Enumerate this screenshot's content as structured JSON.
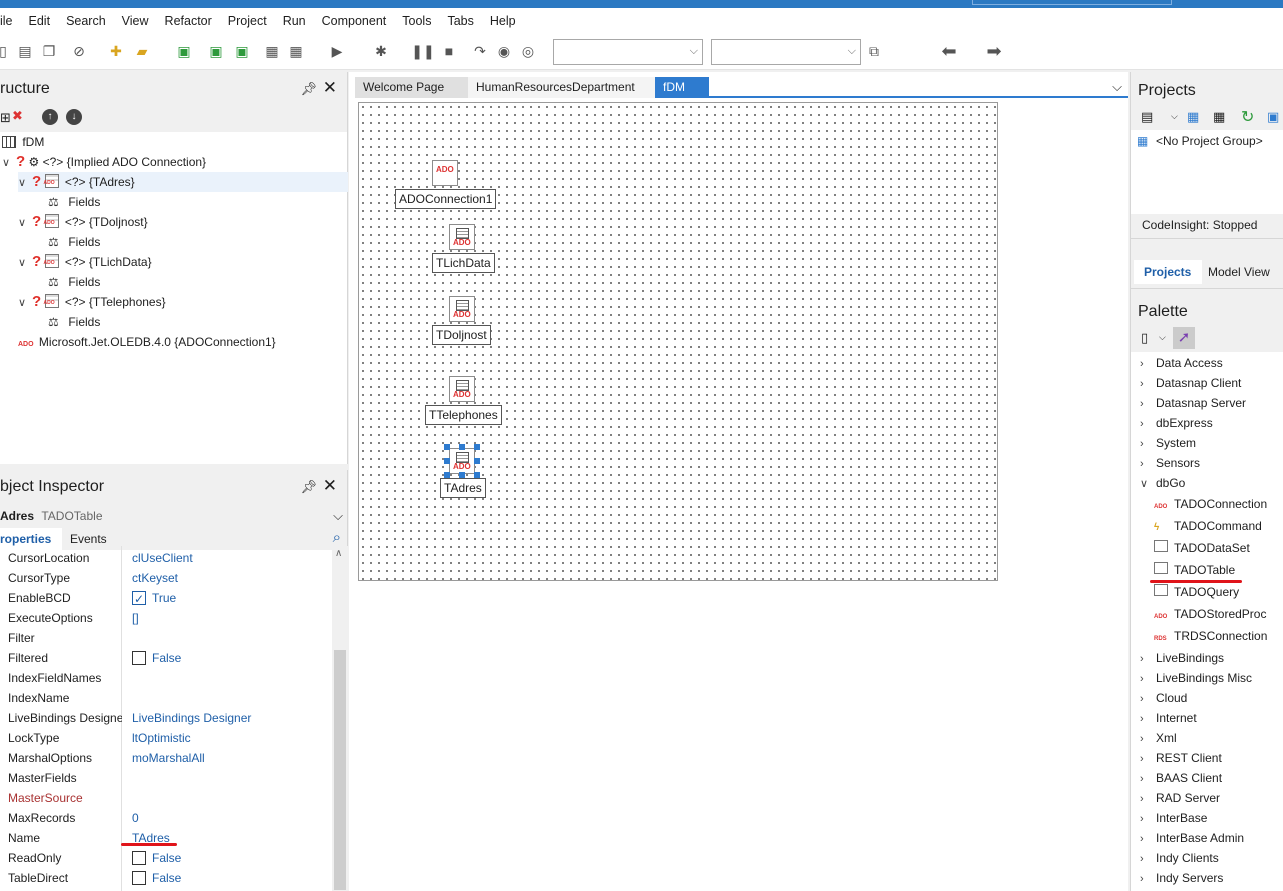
{
  "menubar": {
    "items": [
      "ile",
      "Edit",
      "Search",
      "View",
      "Refactor",
      "Project",
      "Run",
      "Component",
      "Tools",
      "Tabs",
      "Help"
    ]
  },
  "toolbar": {
    "combo1_value": "",
    "combo2_value": ""
  },
  "structure": {
    "title": "ructure",
    "rows": [
      {
        "label": "fDM"
      },
      {
        "label": "<?> {Implied ADO Connection}"
      },
      {
        "label": "<?> {TAdres}"
      },
      {
        "label": "Fields"
      },
      {
        "label": "<?> {TDoljnost}"
      },
      {
        "label": "Fields"
      },
      {
        "label": "<?> {TLichData}"
      },
      {
        "label": "Fields"
      },
      {
        "label": "<?> {TTelephones}"
      },
      {
        "label": "Fields"
      },
      {
        "label": "Microsoft.Jet.OLEDB.4.0 {ADOConnection1}"
      }
    ]
  },
  "inspector": {
    "title": "bject Inspector",
    "selected_name": "Adres",
    "selected_type": "TADOTable",
    "tabs": [
      "roperties",
      "Events"
    ],
    "properties": [
      {
        "name": "CursorLocation",
        "value": "clUseClient"
      },
      {
        "name": "CursorType",
        "value": "ctKeyset"
      },
      {
        "name": "EnableBCD",
        "value": "True",
        "checkbox": true,
        "checked": true
      },
      {
        "name": "ExecuteOptions",
        "value": "[]"
      },
      {
        "name": "Filter",
        "value": ""
      },
      {
        "name": "Filtered",
        "value": "False",
        "checkbox": true,
        "checked": false
      },
      {
        "name": "IndexFieldNames",
        "value": ""
      },
      {
        "name": "IndexName",
        "value": ""
      },
      {
        "name": "LiveBindings Designe",
        "value": "LiveBindings Designer"
      },
      {
        "name": "LockType",
        "value": "ltOptimistic"
      },
      {
        "name": "MarshalOptions",
        "value": "moMarshalAll"
      },
      {
        "name": "MasterFields",
        "value": ""
      },
      {
        "name": "MasterSource",
        "value": "",
        "link": true
      },
      {
        "name": "MaxRecords",
        "value": "0"
      },
      {
        "name": "Name",
        "value": "TAdres"
      },
      {
        "name": "ReadOnly",
        "value": "False",
        "checkbox": true,
        "checked": false
      },
      {
        "name": "TableDirect",
        "value": "False",
        "checkbox": true,
        "checked": false
      }
    ]
  },
  "editor_tabs": {
    "welcome": "Welcome Page",
    "hr": "HumanResourcesDepartment",
    "fdm": "fDM"
  },
  "form_components": [
    {
      "label": "ADOConnection1",
      "icon_text": "ADO"
    },
    {
      "label": "TLichData"
    },
    {
      "label": "TDoljnost"
    },
    {
      "label": "TTelephones"
    },
    {
      "label": "TAdres"
    }
  ],
  "projects": {
    "title": "Projects",
    "group": "<No Project Group>",
    "codeinsight": "CodeInsight: Stopped",
    "tab_projects": "Projects",
    "tab_model": "Model View"
  },
  "palette": {
    "title": "Palette",
    "categories_top": [
      "Data Access",
      "Datasnap Client",
      "Datasnap Server",
      "dbExpress",
      "System",
      "Sensors"
    ],
    "expanded": "dbGo",
    "dbgo_items": [
      "TADOConnection",
      "TADOCommand",
      "TADODataSet",
      "TADOTable",
      "TADOQuery",
      "TADOStoredProc",
      "TRDSConnection"
    ],
    "categories_bottom": [
      "LiveBindings",
      "LiveBindings Misc",
      "Cloud",
      "Internet",
      "Xml",
      "REST Client",
      "BAAS Client",
      "RAD Server",
      "InterBase",
      "InterBase Admin",
      "Indy Clients",
      "Indy Servers"
    ]
  },
  "colors": {
    "accent": "#2e7bcf",
    "annotation_red": "#e0141a"
  }
}
